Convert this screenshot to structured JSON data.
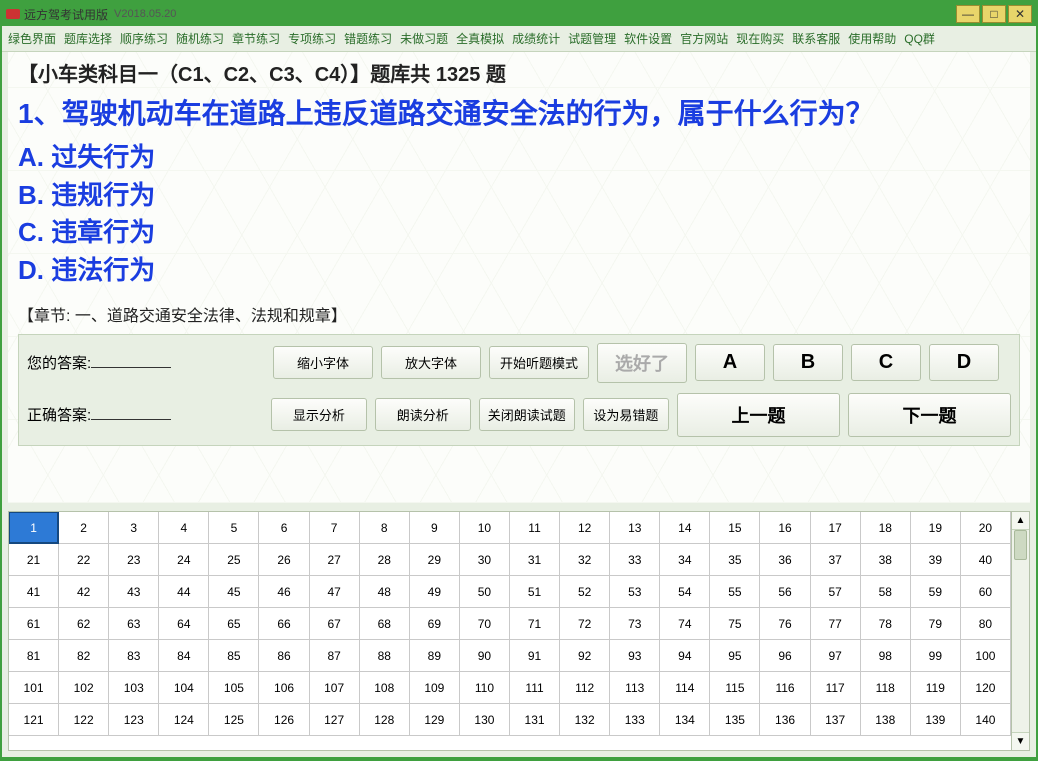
{
  "window": {
    "title": "远方驾考试用版",
    "version": "V2018.05.20"
  },
  "menu": [
    "绿色界面",
    "题库选择",
    "顺序练习",
    "随机练习",
    "章节练习",
    "专项练习",
    "错题练习",
    "未做习题",
    "全真模拟",
    "成绩统计",
    "试题管理",
    "软件设置",
    "官方网站",
    "现在购买",
    "联系客服",
    "使用帮助",
    "QQ群"
  ],
  "bank_title": "【小车类科目一（C1、C2、C3、C4）】题库共 1325 题",
  "question": {
    "number": "1、",
    "text": "驾驶机动车在道路上违反道路交通安全法的行为，属于什么行为？",
    "options": {
      "A": "过失行为",
      "B": "违规行为",
      "C": "违章行为",
      "D": "违法行为"
    }
  },
  "chapter": "【章节: 一、道路交通安全法律、法规和规章】",
  "labels": {
    "your_answer": "您的答案:",
    "correct_answer": "正确答案:"
  },
  "buttons": {
    "shrink_font": "缩小字体",
    "enlarge_font": "放大字体",
    "start_listen": "开始听题模式",
    "chosen": "选好了",
    "show_analysis": "显示分析",
    "read_analysis": "朗读分析",
    "stop_read": "关闭朗读试题",
    "mark_wrong": "设为易错题",
    "prev": "上一题",
    "next": "下一题"
  },
  "answer_choices": [
    "A",
    "B",
    "C",
    "D"
  ],
  "grid": {
    "current": 1,
    "from": 1,
    "to": 140
  }
}
